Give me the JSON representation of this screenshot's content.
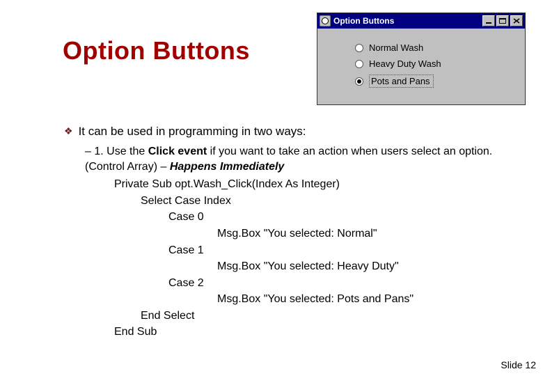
{
  "title": "Option Buttons",
  "window": {
    "titlebar": "Option Buttons",
    "options": {
      "opt0": "Normal Wash",
      "opt1": "Heavy Duty Wash",
      "opt2": "Pots and Pans"
    }
  },
  "body": {
    "lead": "It can be used in programming in two ways:",
    "sub_prefix": "– 1. Use the ",
    "click_event": "Click event",
    "sub_mid": " if you want to take an action when users select an option. (Control Array) – ",
    "happens": "Happens Immediately",
    "code": {
      "l0": "Private Sub opt.Wash_Click(Index As Integer)",
      "l1": "Select Case Index",
      "l2": "Case 0",
      "l3": "Msg.Box \"You selected: Normal\"",
      "l4": "Case 1",
      "l5": "Msg.Box \"You selected: Heavy Duty\"",
      "l6": "Case 2",
      "l7": "Msg.Box \"You selected: Pots and Pans\"",
      "l8": "End Select",
      "l9": "End Sub"
    }
  },
  "footer": "Slide 12"
}
